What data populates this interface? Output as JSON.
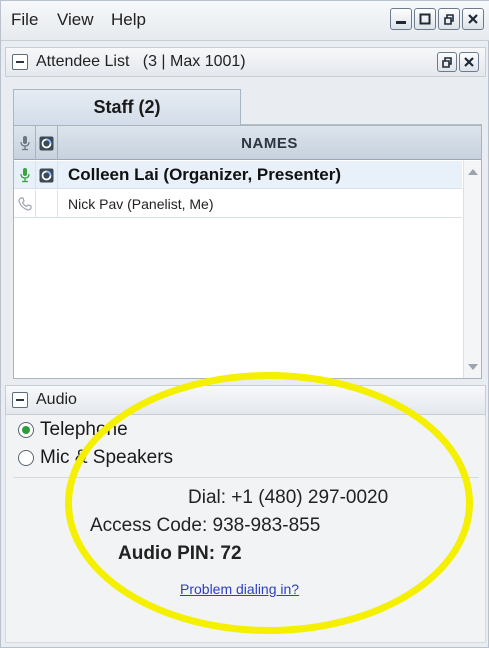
{
  "menubar": {
    "items": [
      "File",
      "View",
      "Help"
    ]
  },
  "attendee_panel": {
    "title": "Attendee List",
    "count": "(3 | Max 1001)"
  },
  "tabs": [
    {
      "label": "Staff (2)",
      "active": true
    }
  ],
  "table": {
    "header_names": "NAMES",
    "rows": [
      {
        "name": "Colleen Lai (Organizer, Presenter)",
        "audio_icon": "microphone-icon",
        "status_icon": "webex-icon",
        "highlighted": true
      },
      {
        "name": "Nick Pav (Panelist, Me)",
        "audio_icon": "phone-icon",
        "status_icon": "",
        "highlighted": false
      }
    ]
  },
  "audio": {
    "title": "Audio",
    "options": [
      {
        "label": "Telephone",
        "selected": true
      },
      {
        "label": "Mic & Speakers",
        "selected": false
      }
    ],
    "dial_label": "Dial:",
    "dial_number": "+1 (480) 297-0020",
    "access_code_label": "Access Code:",
    "access_code": "938-983-855",
    "pin_label": "Audio PIN:",
    "pin": "72",
    "problem_link": "Problem dialing in?"
  },
  "colors": {
    "highlight": "#f4f000",
    "link": "#2a3fc2",
    "radio_selected": "#2f9c3a"
  }
}
